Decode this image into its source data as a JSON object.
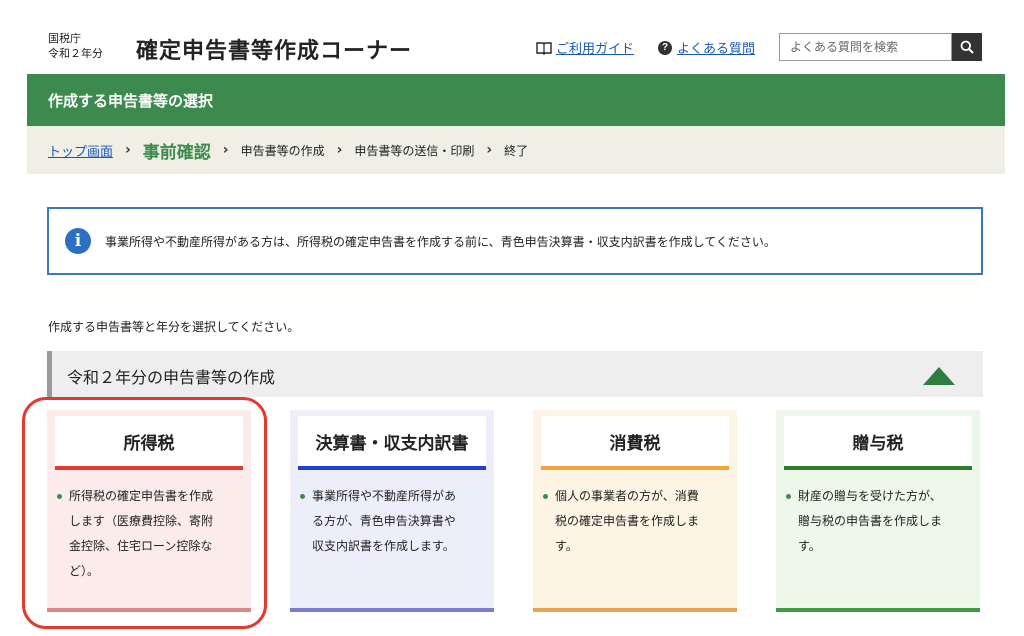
{
  "header": {
    "agency_line1": "国税庁",
    "agency_line2": "令和２年分",
    "app_title": "確定申告書等作成コーナー",
    "guide_label": "ご利用ガイド",
    "faq_label": "よくある質問",
    "search_placeholder": "よくある質問を検索",
    "icons": {
      "guide": "book-icon",
      "faq": "question-circle-icon",
      "search": "search-icon"
    }
  },
  "page_title": "作成する申告書等の選択",
  "breadcrumb": [
    "トップ画面",
    "事前確認",
    "申告書等の作成",
    "申告書等の送信・印刷",
    "終了"
  ],
  "info_message": "事業所得や不動産所得がある方は、所得税の確定申告書を作成する前に、青色申告決算書・収支内訳書を作成してください。",
  "instruction": "作成する申告書等と年分を選択してください。",
  "section": {
    "title": "令和２年分の申告書等の作成",
    "toggle_icon": "triangle-up-icon"
  },
  "cards": [
    {
      "title": "所得税",
      "lines": [
        "所得税の確定申告書を作成",
        "します（医療費控除、寄附",
        "金控除、住宅ローン控除な",
        "ど）。"
      ],
      "accent": "#e23a30",
      "bg": "#fbeceb",
      "bottom": "#d88a86"
    },
    {
      "title": "決算書・収支内訳書",
      "lines": [
        "事業所得や不動産所得があ",
        "る方が、青色申告決算書や",
        "収支内訳書を作成します。"
      ],
      "accent": "#1c3fd6",
      "bg": "#eeeefb",
      "bottom": "#7a7ed2"
    },
    {
      "title": "消費税",
      "lines": [
        "個人の事業者の方が、消費",
        "税の確定申告書を作成しま",
        "す。"
      ],
      "accent": "#f2a33a",
      "bg": "#fdf4e3",
      "bottom": "#e6a552"
    },
    {
      "title": "贈与税",
      "lines": [
        "財産の贈与を受けた方が、",
        "贈与税の申告書を作成しま",
        "す。"
      ],
      "accent": "#2e7d2e",
      "bg": "#eef8ea",
      "bottom": "#3f9a44"
    }
  ],
  "colors": {
    "brand_green": "#3d8a4e",
    "link_blue": "#1a58b6",
    "highlight_red": "#e23a30"
  }
}
